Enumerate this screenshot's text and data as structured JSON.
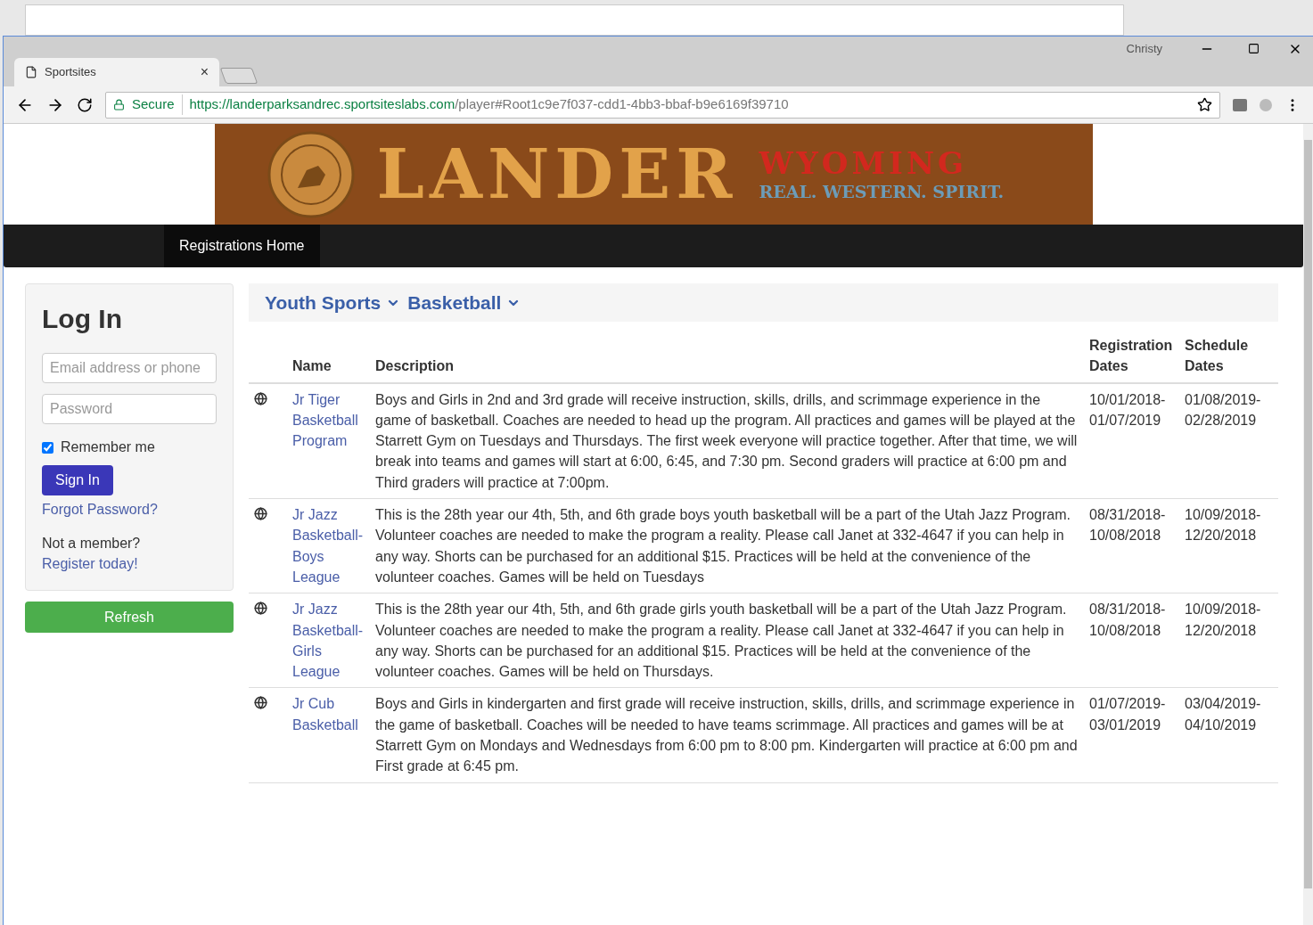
{
  "browser": {
    "profile": "Christy",
    "tab": {
      "title": "Sportsites",
      "close": "×"
    },
    "secure_label": "Secure",
    "url_host": "https://landerparksandrec.sportsiteslabs.com",
    "url_path": "/player#Root1c9e7f037-cdd1-4bb3-bbaf-b9e6169f39710"
  },
  "banner": {
    "title": "LANDER",
    "subtitle": "WYOMING",
    "tagline": "REAL. WESTERN. SPIRIT."
  },
  "nav": {
    "items": [
      {
        "label": "Registrations Home",
        "selected": true
      }
    ]
  },
  "login": {
    "title": "Log In",
    "email": {
      "placeholder": "Email address or phone"
    },
    "password": {
      "placeholder": "Password"
    },
    "remember": {
      "label": "Remember me",
      "checked": true
    },
    "sign_in": "Sign In",
    "forgot": "Forgot Password?",
    "not_member": "Not a member?",
    "register": "Register today!",
    "refresh": "Refresh"
  },
  "breadcrumb": [
    "Youth Sports",
    "Basketball"
  ],
  "table": {
    "columns": [
      "Name",
      "Description",
      "Registration Dates",
      "Schedule Dates"
    ],
    "rows": [
      {
        "name": "Jr Tiger Basketball Program",
        "description": "Boys and Girls in 2nd and 3rd grade will receive instruction, skills, drills, and scrimmage experience in the game of basketball. Coaches are needed to head up the program. All practices and games will be played at the Starrett Gym on Tuesdays and Thursdays. The first week everyone will practice together. After that time, we will break into teams and games will start at 6:00, 6:45, and 7:30 pm. Second graders will practice at 6:00 pm and Third graders will practice at 7:00pm.",
        "registration": "10/01/2018-01/07/2019",
        "schedule": "01/08/2019-02/28/2019"
      },
      {
        "name": "Jr Jazz Basketball-Boys League",
        "description": "This is the 28th year our 4th, 5th, and 6th grade boys youth basketball will be a part of the Utah Jazz Program. Volunteer coaches are needed to make the program a reality. Please call Janet at 332-4647 if you can help in any way. Shorts can be purchased for an additional $15. Practices will be held at the convenience of the volunteer coaches. Games will be held on Tuesdays",
        "registration": "08/31/2018-10/08/2018",
        "schedule": "10/09/2018-12/20/2018"
      },
      {
        "name": "Jr Jazz Basketball-Girls League",
        "description": "This is the 28th year our 4th, 5th, and 6th grade girls youth basketball will be a part of the Utah Jazz Program. Volunteer coaches are needed to make the program a reality. Please call Janet at 332-4647 if you can help in any way. Shorts can be purchased for an additional $15. Practices will be held at the convenience of the volunteer coaches. Games will be held on Thursdays.",
        "registration": "08/31/2018-10/08/2018",
        "schedule": "10/09/2018-12/20/2018"
      },
      {
        "name": "Jr Cub Basketball",
        "description": "Boys and Girls in kindergarten and first grade will receive instruction, skills, drills, and scrimmage experience in the game of basketball. Coaches will be needed to have teams scrimmage. All practices and games will be at Starrett Gym on Mondays and Wednesdays from 6:00 pm to 8:00 pm. Kindergarten will practice at 6:00 pm and First grade at 6:45 pm.",
        "registration": "01/07/2019-03/01/2019",
        "schedule": "03/04/2019-04/10/2019"
      }
    ]
  }
}
